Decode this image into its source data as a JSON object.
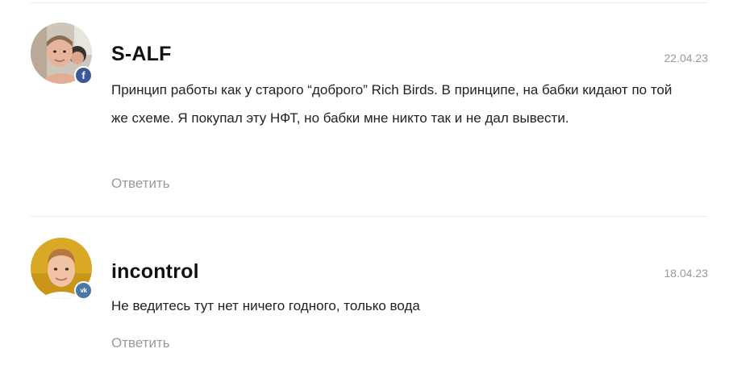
{
  "comments": [
    {
      "author": "S-ALF",
      "date": "22.04.23",
      "text": "Принцип работы как у старого “доброго” Rich Birds. В принципе, на бабки кидают по той же схеме. Я покупал эту НФТ, но бабки мне никто так и не дал вывести.",
      "reply_label": "Ответить",
      "social_icon": "facebook-icon",
      "social_glyph": "f",
      "social_color": "#3b5998"
    },
    {
      "author": "incontrol",
      "date": "18.04.23",
      "text": "Не ведитесь тут нет ничего годного, только вода",
      "reply_label": "Ответить",
      "social_icon": "vk-icon",
      "social_glyph": "vk",
      "social_color": "#4a76a8"
    }
  ],
  "colors": {
    "date": "#9a9a9a",
    "reply": "#9a9a9a",
    "divider": "#ececec"
  }
}
